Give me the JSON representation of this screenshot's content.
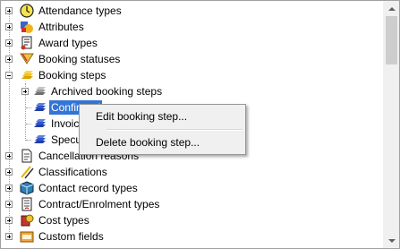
{
  "tree": {
    "items": [
      {
        "label": "Attendance types",
        "icon": "attendance-clock-icon",
        "expander": "plus"
      },
      {
        "label": "Attributes",
        "icon": "attributes-shapes-icon",
        "expander": "plus"
      },
      {
        "label": "Award types",
        "icon": "award-scroll-icon",
        "expander": "plus"
      },
      {
        "label": "Booking statuses",
        "icon": "booking-status-funnel-icon",
        "expander": "plus"
      },
      {
        "label": "Booking steps",
        "icon": "booking-steps-yellow-icon",
        "expander": "minus"
      },
      {
        "label": "Archived booking steps",
        "icon": "archived-steps-grey-icon",
        "expander": "plus"
      },
      {
        "label": "Confirmed",
        "icon": "booking-step-blue-icon",
        "selected": true
      },
      {
        "label": "Invoiced",
        "icon": "booking-step-blue-icon"
      },
      {
        "label": "Speculative",
        "icon": "booking-step-blue-icon"
      },
      {
        "label": "Cancellation reasons",
        "icon": "document-icon",
        "expander": "plus"
      },
      {
        "label": "Classifications",
        "icon": "pencils-icon",
        "expander": "plus"
      },
      {
        "label": "Contact record types",
        "icon": "contact-cube-icon",
        "expander": "plus"
      },
      {
        "label": "Contract/Enrolment types",
        "icon": "contract-document-icon",
        "expander": "plus"
      },
      {
        "label": "Cost types",
        "icon": "cost-coins-icon",
        "expander": "plus"
      },
      {
        "label": "Custom fields",
        "icon": "custom-fields-folder-icon",
        "expander": "plus"
      }
    ],
    "visible_selected_text": "Co"
  },
  "context_menu": {
    "edit_label": "Edit booking step...",
    "delete_label": "Delete booking step..."
  }
}
